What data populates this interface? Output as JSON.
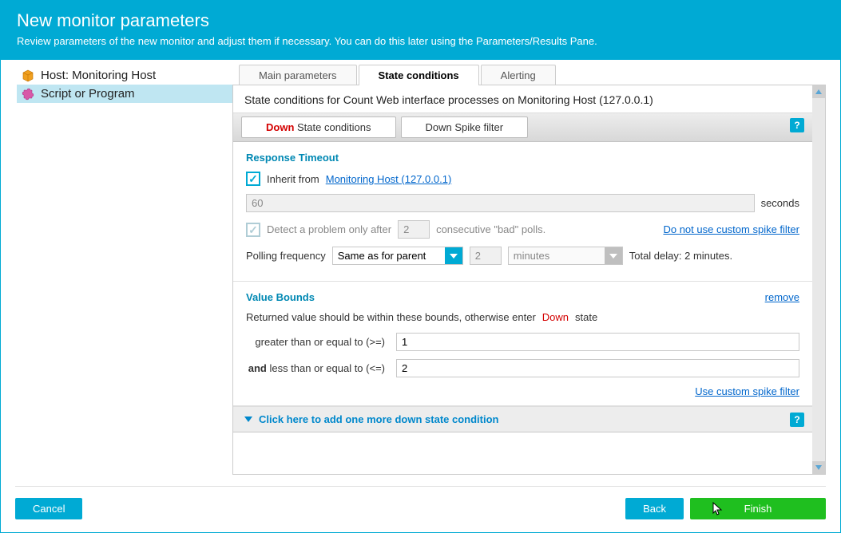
{
  "header": {
    "title": "New monitor parameters",
    "subtitle": "Review parameters of the new monitor and adjust them if necessary. You can do this later using the Parameters/Results Pane."
  },
  "sidebar": {
    "items": [
      {
        "label": "Host: Monitoring Host"
      },
      {
        "label": "Script or Program"
      }
    ]
  },
  "tabs": {
    "main": "Main parameters",
    "state": "State conditions",
    "alerting": "Alerting"
  },
  "panelTitle": "State conditions for Count Web interface processes on Monitoring Host (127.0.0.1)",
  "subtabs": {
    "down_word": "Down",
    "down_rest": " State conditions",
    "spike": "Down Spike filter"
  },
  "responseTimeout": {
    "title": "Response Timeout",
    "inherit_label": "Inherit from",
    "inherit_link": "Monitoring Host (127.0.0.1)",
    "timeout_value": "60",
    "timeout_unit": "seconds",
    "detect_label": "Detect a problem only after",
    "detect_value": "2",
    "detect_suffix": "consecutive \"bad\" polls.",
    "no_spike_link": "Do not use custom spike filter",
    "polling_label": "Polling frequency",
    "polling_value": "Same as for parent",
    "polling_interval": "2",
    "polling_unit": "minutes",
    "total_delay": "Total delay: 2 minutes."
  },
  "valueBounds": {
    "title": "Value Bounds",
    "remove": "remove",
    "intro_pre": "Returned value should be within these bounds, otherwise enter ",
    "intro_down": "Down",
    "intro_post": " state",
    "gte_label": "greater than or equal to (>=)",
    "gte_value": "1",
    "and_word": "and",
    "lte_label": " less than or equal to (<=)",
    "lte_value": "2",
    "custom_spike": "Use custom spike filter"
  },
  "addMore": "Click here to add one more down state condition",
  "footer": {
    "cancel": "Cancel",
    "back": "Back",
    "finish": "Finish"
  }
}
